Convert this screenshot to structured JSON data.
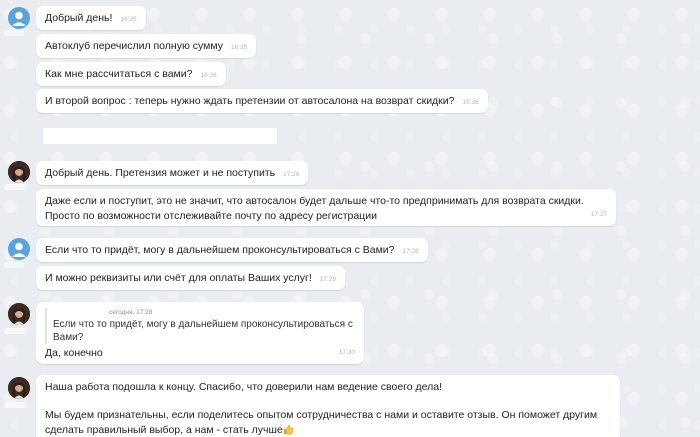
{
  "messages": [
    {
      "text": "Добрый день!",
      "time": "16:35"
    },
    {
      "text": "Автоклуб перечислил полную сумму",
      "time": "16:35"
    },
    {
      "text": "Как мне рассчитаться с вами?",
      "time": "16:36"
    },
    {
      "text": "И второй вопрос : теперь нужно ждать претензии от автосалона на возврат скидки?",
      "time": "16:36"
    },
    {
      "text": "Добрый день. Претензия может и не поступить",
      "time": "17:26"
    },
    {
      "text": "Даже если и поступит, это не значит, что автосалон будет дальше что-то предпринимать для возврата скидки. Просто по возможности отслеживайте почту по адресу регистрации",
      "time": "17:27"
    },
    {
      "text": "Если что то придёт, могу в дальнейшем проконсультироваться с Вами?",
      "time": "17:28"
    },
    {
      "text": "И можно реквизиты или счёт для оплаты Ваших услуг!",
      "time": "17:29"
    },
    {
      "quote_meta": "сегодня, 17:28",
      "quote_text": "Если что то придёт, могу в дальнейшем проконсультироваться с Вами?",
      "text": "Да, конечно",
      "time": "17:30"
    },
    {
      "text_line1": "Наша работа подошла к концу. Спасибо, что доверили нам ведение своего дела!",
      "text_line2": "Мы будем признательны, если поделитесь опытом сотрудничества с нами и оставите отзыв. Он поможет другим сделать правильный выбор, а нам - стать лучше"
    }
  ],
  "icons": {
    "client_avatar": "user-avatar-icon",
    "lawyer_avatar": "lawyer-avatar",
    "thumbs": "thumbs-up-icon"
  },
  "colors": {
    "background": "#e9ecf0",
    "bubble": "#ffffff",
    "client_avatar": "#5aa3dc",
    "timestamp": "#b3b8bf"
  }
}
